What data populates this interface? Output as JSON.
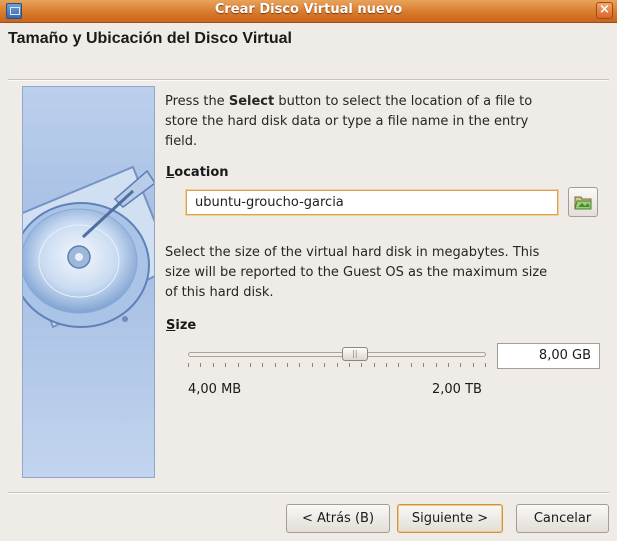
{
  "window": {
    "title": "Crear Disco Virtual nuevo",
    "close_symbol": "×",
    "accent": "#d97a2c"
  },
  "page": {
    "heading": "Tamaño y Ubicación del Disco Virtual"
  },
  "location_section": {
    "description_prefix": "Press the ",
    "description_bold": "Select",
    "description_line1_suffix": " button to select the location of a file to",
    "description_line2": "store the hard disk data or type a file name in the entry",
    "description_line3": "field.",
    "label_first": "L",
    "label_rest": "ocation",
    "value": "ubuntu-groucho-garcia",
    "browse_icon": "folder-open-icon"
  },
  "size_section": {
    "description_line1": "Select the size of the virtual hard disk in megabytes. This",
    "description_line2": "size will be reported to the Guest OS as the maximum size",
    "description_line3": "of this hard disk.",
    "label_first": "S",
    "label_rest": "ize",
    "value": "8,00 GB",
    "slider_min_label": "4,00 MB",
    "slider_max_label": "2,00 TB",
    "slider_position_fraction": 0.56
  },
  "buttons": {
    "back_label": "< Atrás (B)",
    "next_label": "Siguiente >",
    "cancel_label": "Cancelar"
  }
}
